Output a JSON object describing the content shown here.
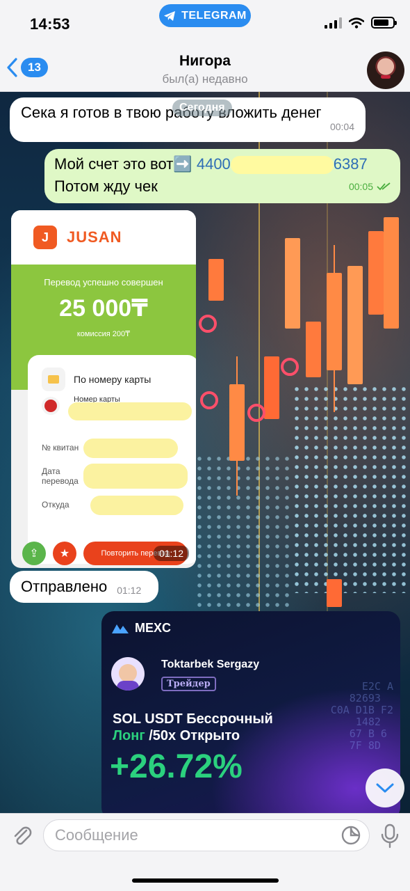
{
  "status_bar": {
    "time": "14:53",
    "app_pill": "TELEGRAM"
  },
  "header": {
    "back_count": "13",
    "title": "Нигора",
    "subtitle": "был(а) недавно"
  },
  "chat": {
    "date_chip": "Сегодня",
    "messages": [
      {
        "direction": "in",
        "text": "Сека я готов в твою работу вложить денег",
        "time": "00:04"
      },
      {
        "direction": "out",
        "line1_prefix": "Мой счет это вот",
        "emoji": "➡️",
        "card_start": "4400",
        "card_end": "6387",
        "line2": "Потом жду чек",
        "time": "00:05",
        "read": true
      },
      {
        "direction": "in",
        "type": "image",
        "time": "01:12"
      },
      {
        "direction": "in",
        "text": "Отправлено",
        "time": "01:12"
      }
    ]
  },
  "receipt": {
    "brand": "JUSAN",
    "status": "Перевод успешно совершен",
    "amount": "25 000₸",
    "fee": "комиссия 200₸",
    "method": "По номеру карты",
    "card_label": "Номер карты",
    "receipt_no_label": "№ квитан",
    "date_label_1": "Дата",
    "date_label_2": "перевода",
    "from_label": "Откуда",
    "repeat_button": "Повторить перевод"
  },
  "mexc_card": {
    "brand": "MEXC",
    "trader_name": "Toktarbek Sergazy",
    "trader_tag": "Трейдер",
    "position_line1": "SOL USDT Бессрочный",
    "position_long": "Лонг",
    "position_rest": "/50x Открыто",
    "pnl": "+26.72%"
  },
  "composer": {
    "placeholder": "Сообщение"
  },
  "colors": {
    "telegram_blue": "#2a8cf0",
    "outgoing_bubble": "#dff8c6",
    "jusan_orange": "#f05a22",
    "jusan_green": "#8cc63f",
    "mexc_green": "#2bd17e"
  }
}
